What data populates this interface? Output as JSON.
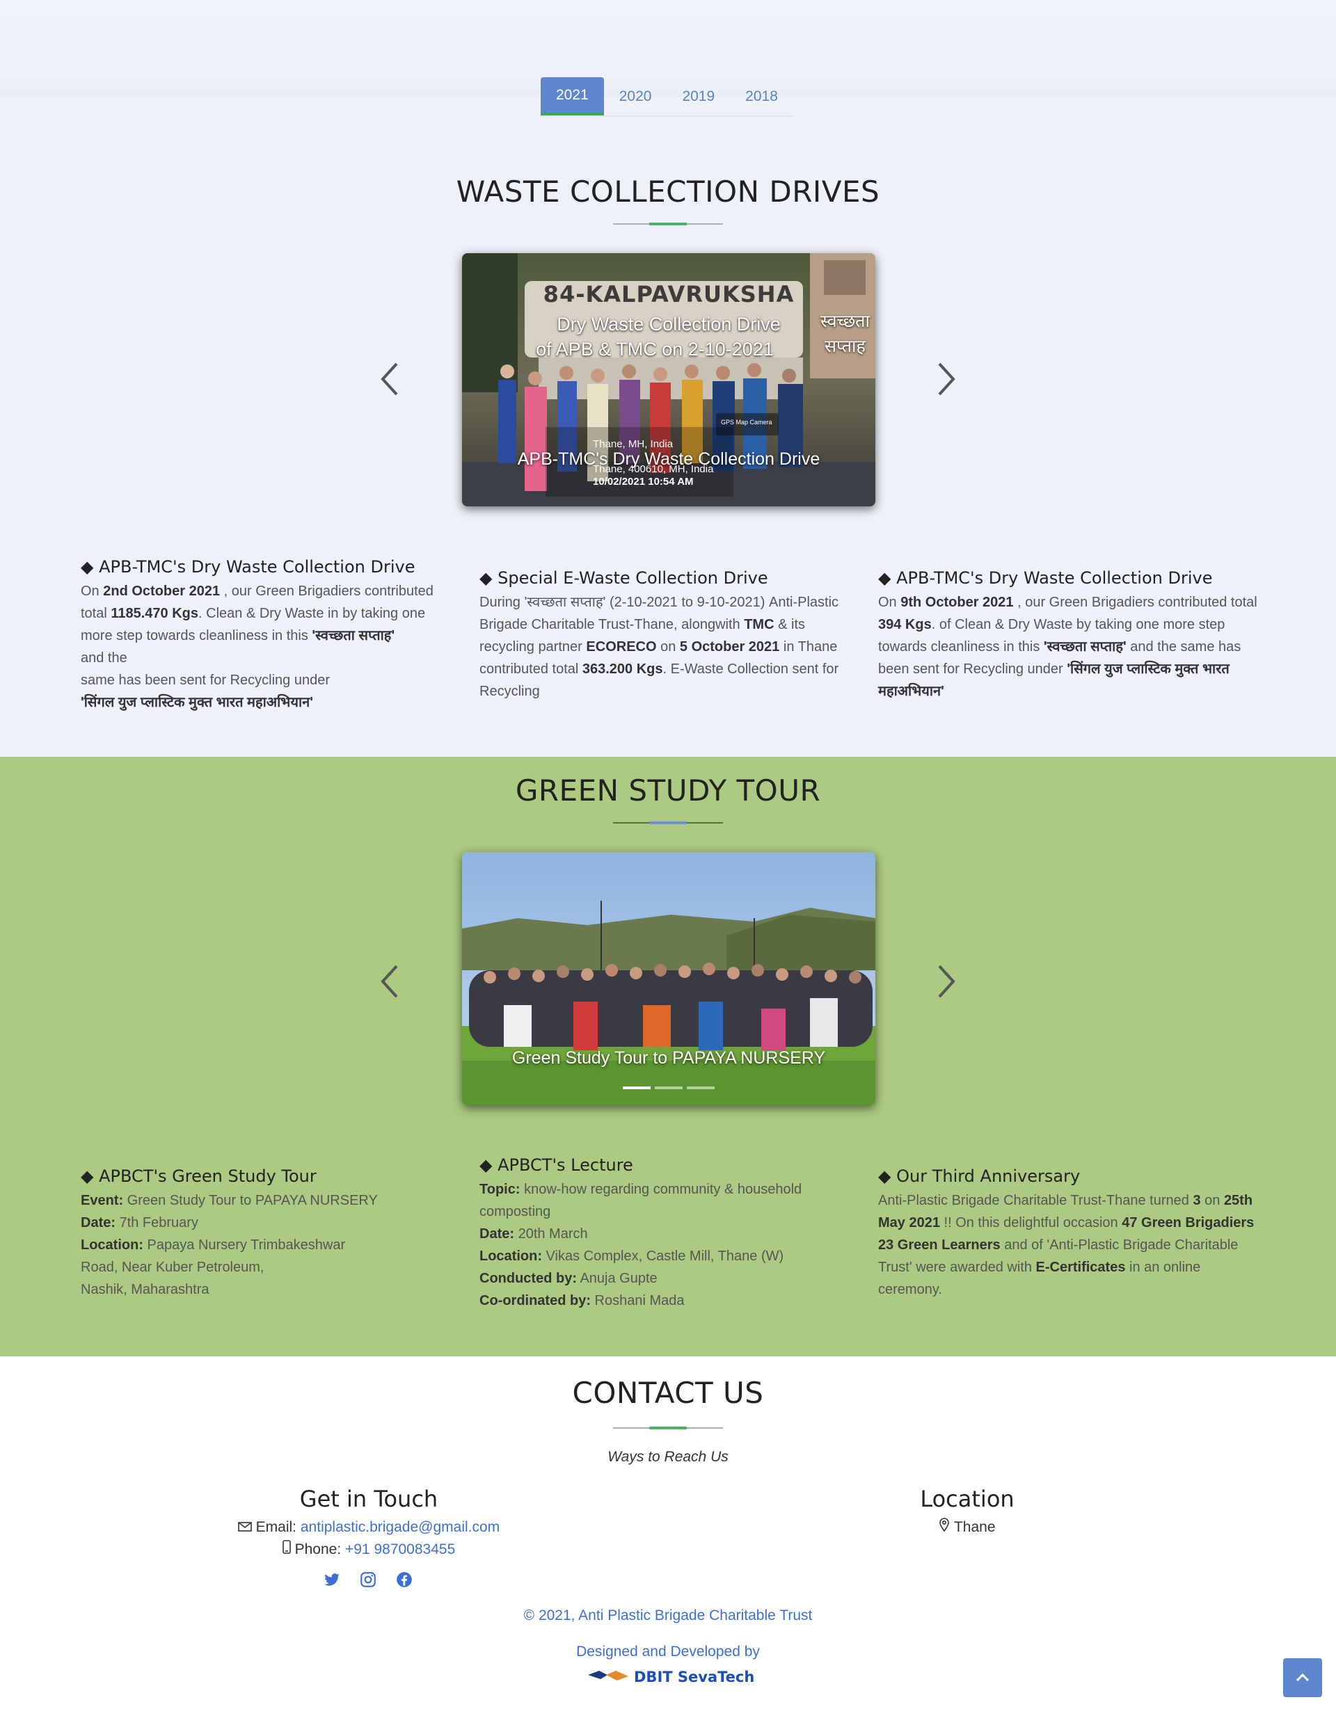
{
  "tabs": [
    {
      "label": "2021",
      "active": true
    },
    {
      "label": "2020",
      "active": false
    },
    {
      "label": "2019",
      "active": false
    },
    {
      "label": "2018",
      "active": false
    }
  ],
  "waste": {
    "title": "WASTE COLLECTION DRIVES",
    "slide": {
      "sign_text": "84-KALPAVRUKSHA",
      "overlay_line1": "Dry Waste Collection Drive",
      "overlay_line2": "of APB & TMC on 2-10-2021",
      "overlay_hindi1": "स्वच्छता",
      "overlay_hindi2": "सप्ताह",
      "geo1": "Thane, MH, India",
      "geo2": "Thane, 400610, MH, India",
      "geo3": "10/02/2021 10:54 AM",
      "gps_label": "GPS Map Camera",
      "caption": "APB-TMC's Dry Waste Collection Drive"
    },
    "cards": [
      {
        "title": "APB-TMC's Dry Waste Collection Drive",
        "p1": "On ",
        "b1": "2nd October 2021",
        "p2": " , our Green Brigadiers contributed total ",
        "b2": "1185.470 Kgs",
        "p3": ". Clean & Dry Waste in by taking one more step towards cleanliness in this ",
        "b3": "'स्वच्छता सप्ताह'",
        "p4": " and the",
        "p5": "same has been sent for Recycling under",
        "b4": "'सिंगल युज प्लास्टिक मुक्त भारत महाअभियान'"
      },
      {
        "title": "Special E-Waste Collection Drive",
        "p1": "During 'स्वच्छता सप्ताह' (2-10-2021 to 9-10-2021) Anti-Plastic Brigade Charitable Trust-Thane, alongwith ",
        "b1": "TMC",
        "p2": " & its recycling partner ",
        "b2": "ECORECO",
        "p3": " on ",
        "b3": "5 October 2021",
        "p4": " in Thane contributed total ",
        "b4": "363.200 Kgs",
        "p5": ". E-Waste Collection sent for Recycling"
      },
      {
        "title": "APB-TMC's Dry Waste Collection Drive",
        "p1": "On ",
        "b1": "9th October 2021",
        "p2": " , our Green Brigadiers contributed total ",
        "b2": "394 Kgs",
        "p3": ". of Clean & Dry Waste by taking one more step towards cleanliness in this ",
        "b3": "'स्वच्छता सप्ताह'",
        "p4": " and the same has been sent for Recycling under ",
        "b4": "'सिंगल युज प्लास्टिक मुक्त भारत महाअभियान'"
      }
    ]
  },
  "green": {
    "title": "GREEN STUDY TOUR",
    "slide": {
      "caption": "Green Study Tour to PAPAYA NURSERY"
    },
    "cards": [
      {
        "title": "APBCT's Green Study Tour",
        "rows": [
          {
            "label": "Event:",
            "value": " Green Study Tour to PAPAYA NURSERY"
          },
          {
            "label": "Date:",
            "value": " 7th February"
          },
          {
            "label": "Location:",
            "value": " Papaya Nursery Trimbakeshwar Road, Near Kuber Petroleum,"
          }
        ],
        "extra": "Nashik, Maharashtra"
      },
      {
        "title": "APBCT's Lecture",
        "rows": [
          {
            "label": "Topic:",
            "value": " know-how regarding community & household composting"
          },
          {
            "label": "Date:",
            "value": " 20th March"
          },
          {
            "label": "Location:",
            "value": " Vikas Complex, Castle Mill, Thane (W)"
          },
          {
            "label": "Conducted by:",
            "value": " Anuja Gupte"
          },
          {
            "label": "Co-ordinated by:",
            "value": " Roshani Mada"
          }
        ]
      },
      {
        "title": "Our Third Anniversary",
        "p1": "Anti-Plastic Brigade Charitable Trust-Thane turned ",
        "b1": "3",
        "p2": " on ",
        "b2": "25th May 2021",
        "p3": " !! On this delightful occasion ",
        "b3": "47 Green Brigadiers 23 Green Learners",
        "p4": " and of 'Anti-Plastic Brigade Charitable Trust' were awarded with ",
        "b4": "E-Certificates",
        "p5": " in an online ceremony."
      }
    ]
  },
  "contact": {
    "title": "CONTACT US",
    "subtitle": "Ways to Reach Us",
    "touch_title": "Get in Touch",
    "email_label": "Email:",
    "email": "antiplastic.brigade@gmail.com",
    "phone_label": "Phone:",
    "phone": "+91 9870083455",
    "location_title": "Location",
    "location": "Thane"
  },
  "footer": {
    "copyright": "© 2021, Anti Plastic Brigade Charitable Trust",
    "designed": "Designed and Developed by",
    "brand": "DBIT SevaTech"
  },
  "colors": {
    "accent": "#5f87cf",
    "green_bg": "#acca82",
    "top_bg": "#eef2f8",
    "link": "#3b6fd4"
  }
}
